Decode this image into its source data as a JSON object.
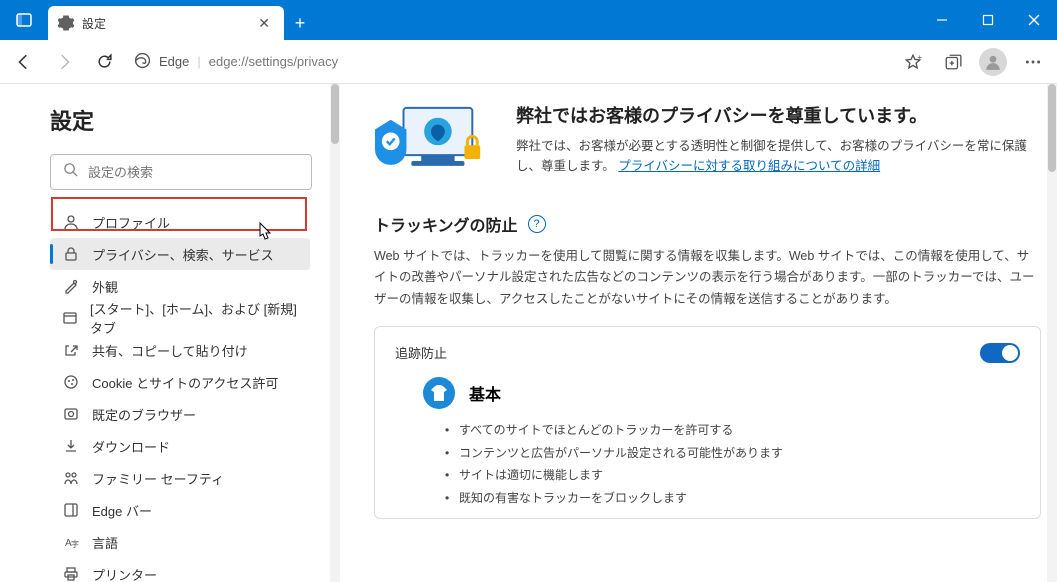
{
  "tab": {
    "title": "設定"
  },
  "address": {
    "brand": "Edge",
    "url": "edge://settings/privacy"
  },
  "sidebar": {
    "title": "設定",
    "search_placeholder": "設定の検索",
    "items": [
      {
        "icon": "profile-icon",
        "label": "プロファイル"
      },
      {
        "icon": "lock-icon",
        "label": "プライバシー、検索、サービス"
      },
      {
        "icon": "appearance-icon",
        "label": "外観"
      },
      {
        "icon": "panel-icon",
        "label": "[スタート]、[ホーム]、および [新規] タブ"
      },
      {
        "icon": "share-icon",
        "label": "共有、コピーして貼り付け"
      },
      {
        "icon": "cookies-icon",
        "label": "Cookie とサイトのアクセス許可"
      },
      {
        "icon": "default-browser-icon",
        "label": "既定のブラウザー"
      },
      {
        "icon": "download-icon",
        "label": "ダウンロード"
      },
      {
        "icon": "family-icon",
        "label": "ファミリー セーフティ"
      },
      {
        "icon": "edge-bar-icon",
        "label": "Edge バー"
      },
      {
        "icon": "language-icon",
        "label": "言語"
      },
      {
        "icon": "printer-icon",
        "label": "プリンター"
      }
    ],
    "selected_index": 1
  },
  "hero": {
    "title": "弊社ではお客様のプライバシーを尊重しています。",
    "body": "弊社では、お客様が必要とする透明性と制御を提供して、お客様のプライバシーを常に保護し、尊重します。",
    "link": "プライバシーに対する取り組みについての詳細"
  },
  "tracking": {
    "heading": "トラッキングの防止",
    "desc": "Web サイトでは、トラッカーを使用して閲覧に関する情報を収集します。Web サイトでは、この情報を使用して、サイトの改善やパーソナル設定された広告などのコンテンツの表示を行う場合があります。一部のトラッカーでは、ユーザーの情報を収集し、アクセスしたことがないサイトにその情報を送信することがあります。",
    "card": {
      "toggle_label": "追跡防止",
      "toggle_on": true,
      "level_title": "基本",
      "bullets": [
        "すべてのサイトでほとんどのトラッカーを許可する",
        "コンテンツと広告がパーソナル設定される可能性があります",
        "サイトは適切に機能します",
        "既知の有害なトラッカーをブロックします"
      ]
    }
  }
}
